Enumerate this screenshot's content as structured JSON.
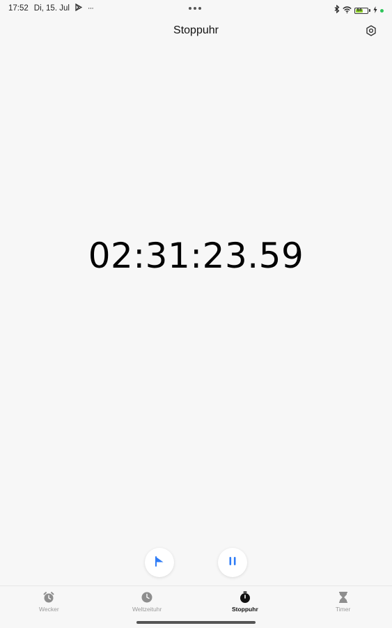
{
  "status_bar": {
    "time": "17:52",
    "date": "Di, 15. Jul",
    "more": "···",
    "battery_level": "64",
    "battery_color": "#8fd12d"
  },
  "header": {
    "title": "Stoppuhr",
    "settings_icon": "settings-hexagon-icon"
  },
  "stopwatch": {
    "time": "02:31:23.59"
  },
  "controls": {
    "lap_icon": "flag-icon",
    "pause_icon": "pause-icon",
    "accent_color": "#2f7cf6"
  },
  "nav": {
    "items": [
      {
        "label": "Wecker",
        "icon": "alarm-clock-icon"
      },
      {
        "label": "Weltzeituhr",
        "icon": "clock-icon"
      },
      {
        "label": "Stoppuhr",
        "icon": "stopwatch-icon",
        "active": true
      },
      {
        "label": "Timer",
        "icon": "hourglass-icon"
      }
    ]
  }
}
